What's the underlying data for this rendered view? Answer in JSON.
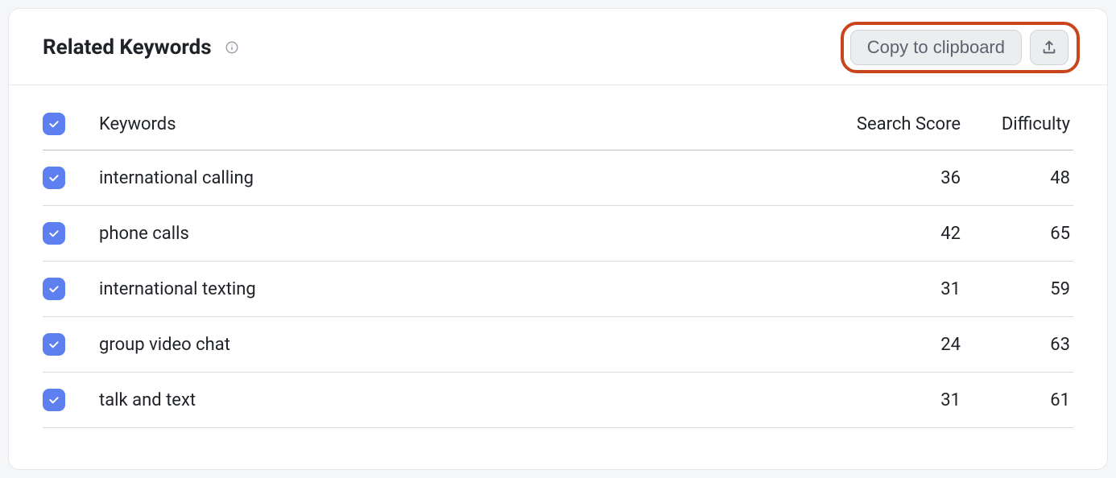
{
  "header": {
    "title": "Related Keywords",
    "copy_label": "Copy to clipboard"
  },
  "columns": {
    "keywords": "Keywords",
    "search_score": "Search Score",
    "difficulty": "Difficulty"
  },
  "rows": [
    {
      "keyword": "international calling",
      "search_score": 36,
      "difficulty": 48
    },
    {
      "keyword": "phone calls",
      "search_score": 42,
      "difficulty": 65
    },
    {
      "keyword": "international texting",
      "search_score": 31,
      "difficulty": 59
    },
    {
      "keyword": "group video chat",
      "search_score": 24,
      "difficulty": 63
    },
    {
      "keyword": "talk and text",
      "search_score": 31,
      "difficulty": 61
    }
  ]
}
